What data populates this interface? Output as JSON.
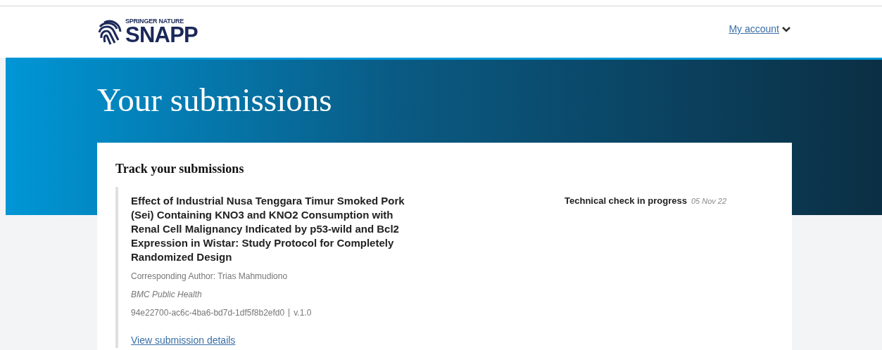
{
  "header": {
    "logo": {
      "publisher": "SPRINGER NATURE",
      "product": "SNAPP"
    },
    "account_link": "My account"
  },
  "page_title": "Your submissions",
  "card": {
    "heading": "Track your submissions",
    "submissions": [
      {
        "title": "Effect of Industrial Nusa Tenggara Timur Smoked Pork (Sei) Containing KNO3 and KNO2 Consumption with Renal Cell Malignancy Indicated by p53-wild and Bcl2 Expression in Wistar: Study Protocol for Completely Randomized Design",
        "author": "Corresponding Author: Trias Mahmudiono",
        "journal": "BMC Public Health",
        "id": "94e22700-ac6c-4ba6-bd7d-1df5f8b2efd0",
        "version": "v.1.0",
        "details_link": "View submission details",
        "status": "Technical check in progress",
        "status_date": "05 Nov 22"
      }
    ]
  }
}
